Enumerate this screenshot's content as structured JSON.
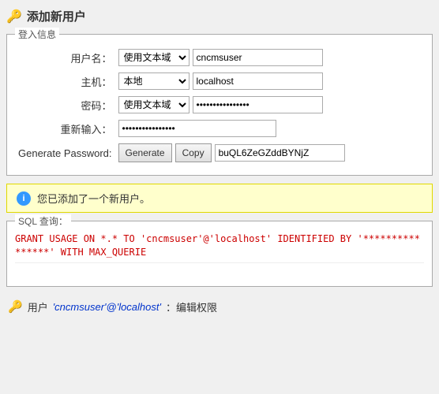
{
  "page": {
    "title": "添加新用户",
    "title_icon": "🔑"
  },
  "login_section": {
    "legend": "登入信息",
    "fields": {
      "username_label": "用户名：",
      "username_type": "使用文本域",
      "username_value": "cncmsuser",
      "host_label": "主机：",
      "host_type": "本地",
      "host_value": "localhost",
      "password_label": "密码：",
      "password_type": "使用文本域",
      "password_value": "••••••••••••••••",
      "reenter_label": "重新输入：",
      "reenter_value": "••••••••••••••••",
      "generate_label": "Generate Password:",
      "generate_btn": "Generate",
      "copy_btn": "Copy",
      "generated_value": "buQL6ZeGZddBYNjZ"
    }
  },
  "notice": {
    "icon": "i",
    "text": "您已添加了一个新用户。"
  },
  "sql_section": {
    "legend": "SQL 查询：",
    "content": "GRANT USAGE ON *.* TO 'cncmsuser'@'localhost' IDENTIFIED BY '****************' WITH MAX_QUERIE"
  },
  "footer": {
    "icon": "🔑",
    "prefix": "用户 ",
    "user_link": "'cncmsuser'@'localhost'",
    "suffix": "：编辑权限"
  }
}
